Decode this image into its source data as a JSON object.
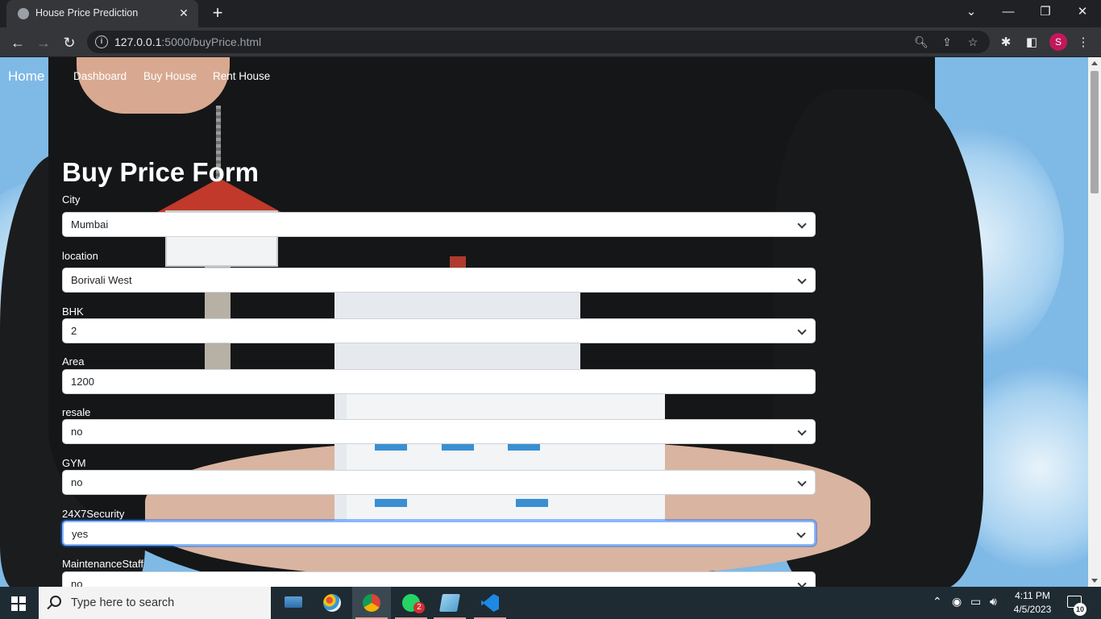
{
  "browser": {
    "tab_title": "House Price Prediction",
    "url_host": "127.0.0.1",
    "url_rest": ":5000/buyPrice.html",
    "avatar_letter": "S"
  },
  "site_nav": {
    "brand": "Home",
    "links": [
      "Dashboard",
      "Buy House",
      "Rent House"
    ]
  },
  "form": {
    "title": "Buy Price Form",
    "fields": [
      {
        "label": "City",
        "value": "Mumbai",
        "type": "select"
      },
      {
        "label": "location",
        "value": "Borivali West",
        "type": "select"
      },
      {
        "label": "BHK",
        "value": "2",
        "type": "select"
      },
      {
        "label": "Area",
        "value": "1200",
        "type": "input"
      },
      {
        "label": "resale",
        "value": "no",
        "type": "select"
      },
      {
        "label": "GYM",
        "value": "no",
        "type": "select"
      },
      {
        "label": "24X7Security",
        "value": "yes",
        "type": "select",
        "focused": true
      },
      {
        "label": "MaintenanceStaff",
        "value": "no",
        "type": "select"
      }
    ]
  },
  "taskbar": {
    "search_placeholder": "Type here to search",
    "whatsapp_badge": "2",
    "time": "4:11 PM",
    "date": "4/5/2023",
    "notification_count": "10"
  },
  "colors": {
    "chrome_dark": "#202124",
    "chrome_toolbar": "#35363a",
    "taskbar": "#1f2b33",
    "focus_ring": "#86b7fe",
    "avatar": "#c2185b"
  }
}
